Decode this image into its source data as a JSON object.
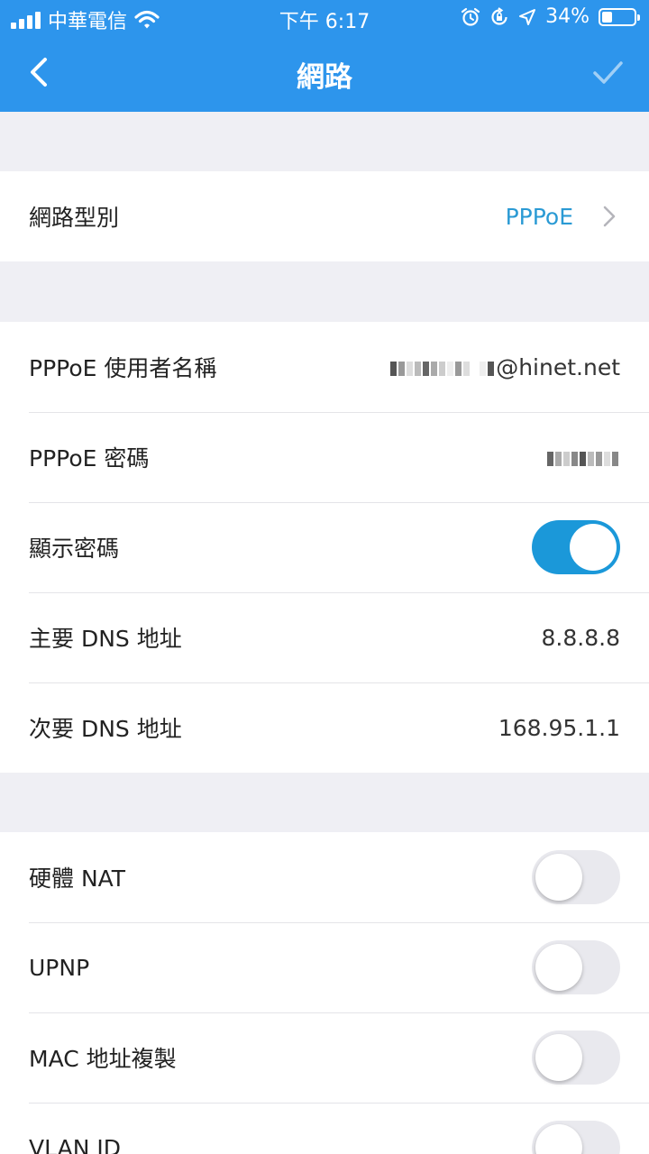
{
  "status_bar": {
    "carrier": "中華電信",
    "time": "下午 6:17",
    "battery": "34%"
  },
  "nav": {
    "title": "網路"
  },
  "network_type": {
    "label": "網路型別",
    "value": "PPPoE"
  },
  "pppoe": {
    "username_label": "PPPoE 使用者名稱",
    "username_visible_suffix": "@hinet.net",
    "password_label": "PPPoE 密碼",
    "show_password_label": "顯示密碼",
    "show_password_on": true,
    "dns_primary_label": "主要 DNS 地址",
    "dns_primary_value": "8.8.8.8",
    "dns_secondary_label": "次要 DNS 地址",
    "dns_secondary_value": "168.95.1.1"
  },
  "advanced": {
    "items": [
      {
        "label": "硬體 NAT",
        "on": false
      },
      {
        "label": "UPNP",
        "on": false
      },
      {
        "label": "MAC 地址複製",
        "on": false
      },
      {
        "label": "VLAN ID",
        "on": false
      }
    ]
  },
  "colors": {
    "header_bg": "#2d95ec",
    "accent_link": "#2a9ad4",
    "toggle_on": "#1b98d9",
    "page_bg": "#efeff4"
  }
}
